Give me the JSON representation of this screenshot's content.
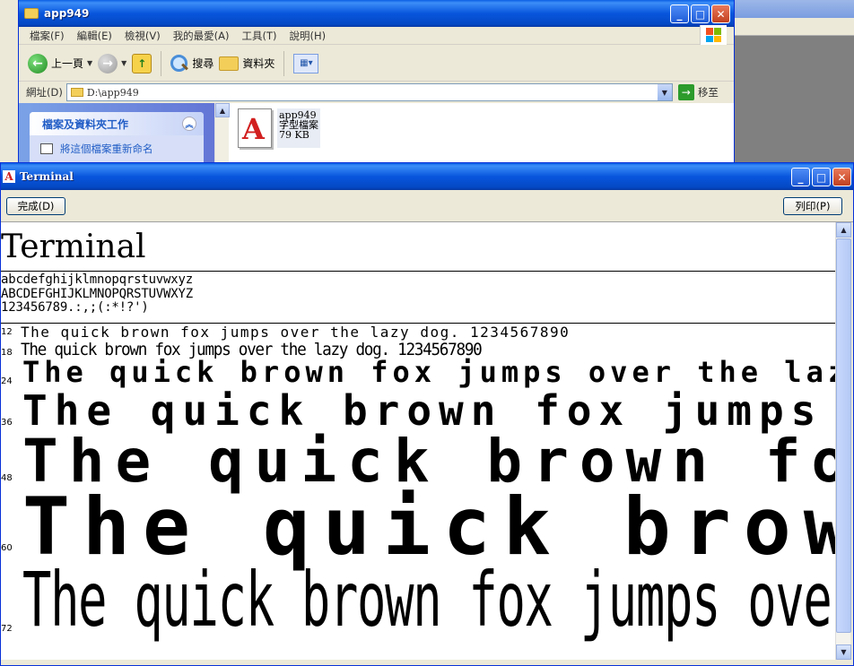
{
  "explorer": {
    "title": "app949",
    "menu": [
      "檔案(F)",
      "編輯(E)",
      "檢視(V)",
      "我的最愛(A)",
      "工具(T)",
      "說明(H)"
    ],
    "toolbar": {
      "back_label": "上一頁",
      "search_label": "搜尋",
      "folders_label": "資料夾"
    },
    "address": {
      "label": "網址(D)",
      "value": "D:\\app949",
      "go_label": "移至"
    },
    "tasks": {
      "header": "檔案及資料夾工作",
      "rename": "將這個檔案重新命名"
    },
    "file": {
      "name": "app949",
      "type": "字型檔案",
      "size": "79 KB",
      "icon_glyph": "A"
    }
  },
  "fontviewer": {
    "title": "Terminal",
    "done_label": "完成(D)",
    "print_label": "列印(P)",
    "font_name": "Terminal",
    "charset_lines": [
      "abcdefghijklmnopqrstuvwxyz",
      "ABCDEFGHIJKLMNOPQRSTUVWXYZ",
      "123456789.:,;(:*!?')"
    ],
    "samples": [
      {
        "size": "12",
        "text": "The quick brown fox jumps over the lazy dog. 1234567890"
      },
      {
        "size": "18",
        "text": "The quick brown fox jumps over the lazy dog. 1234567890"
      },
      {
        "size": "24",
        "text": "The quick brown fox jumps over the laz"
      },
      {
        "size": "36",
        "text": "The quick brown fox jumps"
      },
      {
        "size": "48",
        "text": "The quick brown fox"
      },
      {
        "size": "60",
        "text": "The quick brown"
      },
      {
        "size": "72",
        "text": "The quick brown fox jumps over the la"
      }
    ]
  },
  "colors": {
    "title_bar": "#0856dd",
    "close_button": "#c2411f",
    "font_icon_red": "#d21f1f"
  }
}
